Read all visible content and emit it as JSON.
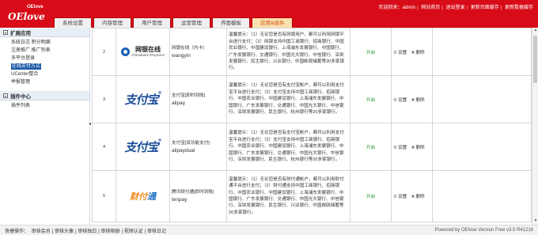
{
  "header": {
    "logo_small": "OElove",
    "logo_brand": "OElove",
    "toplinks": [
      "欢迎回来：admin",
      "网站首页",
      "退出登录",
      "更新页面缓存",
      "更新数据缓存"
    ],
    "tabs": [
      {
        "label": "系统设置",
        "active": false
      },
      {
        "label": "内容管理",
        "active": false
      },
      {
        "label": "用户管理",
        "active": false
      },
      {
        "label": "运营管理",
        "active": false
      },
      {
        "label": "界面模板",
        "active": false
      },
      {
        "label": "应用&插件",
        "active": true
      }
    ]
  },
  "sidebar": {
    "section1": "扩展应用",
    "items1": [
      "系统日志 积分明细",
      "注册推广 推广列表",
      "多平台登录",
      "在线支付方式",
      "UCenter整合",
      "举报管理"
    ],
    "active_item": "在线支付方式",
    "section2": "插件中心",
    "items2": [
      "插件列表"
    ]
  },
  "table": {
    "status_on": "开启",
    "op_set": "设置",
    "op_del": "删除",
    "rows": [
      {
        "idx": "2",
        "logo": "chinabank",
        "logo_text": "网银在线",
        "logo_sub": "Chinabank iPayment",
        "name": "网银在线（内卡）",
        "code": "wangyin",
        "desc": "温馨提示：（1）无论您是否有网银用户，都可以利用网银平台进行支付；（2）网银支持中国工商银行、招商银行、中国农业银行、中国建设银行、上海浦东发展银行、中国银行、广东发展银行、交通银行、中国光大银行、中信银行、深圳发展银行、民生银行、兴业银行、中国邮政储蓄等20多家银行。"
      },
      {
        "idx": "3",
        "logo": "alipay",
        "logo_text": "支付宝",
        "name": "支付宝[即时到账]",
        "code": "alipay",
        "desc": "温馨提示：（1）无论您是否有支付宝帐户，都可以利用支付宝平台进行支付；（2）支付宝支持中国工商银行、招商银行、中国农业银行、中国建设银行、上海浦东发展银行、中国银行、广东发展银行、交通银行、中国光大银行、中信银行、深圳发展银行、民生银行、杭州银行等20多家银行。"
      },
      {
        "idx": "4",
        "logo": "alipay",
        "logo_text": "支付宝",
        "name": "支付宝[双功能支付]",
        "code": "alipaydual",
        "desc": "温馨提示：（1）无论您是否有支付宝帐户，都可以利用支付宝平台进行支付；（2）支付宝支持中国工商银行、招商银行、中国农业银行、中国建设银行、上海浦东发展银行、中国银行、广东发展银行、交通银行、中国光大银行、中信银行、深圳发展银行、民生银行、杭州银行等20多家银行。"
      },
      {
        "idx": "5",
        "logo": "tenpay",
        "logo_text_a": "财付",
        "logo_text_b": "通",
        "name": "腾讯财付通[即时到账]",
        "code": "tenpay",
        "desc": "温馨提示：（1）无论您是否有财付通帐户，都可以利用财付通平台进行支付；（2）财付通支持中国工商银行、招商银行、中国农业银行、中国建设银行、上海浦东发展银行、中国银行、广东发展银行、交通银行、中国光大银行、中信银行、深圳发展银行、民生银行、兴业银行、中国邮政储蓄等20多家银行。"
      }
    ]
  },
  "footer": {
    "links": [
      "快捷操作：",
      "审核会员",
      "审核头像",
      "审核独白",
      "审核相册",
      "视频认证",
      "审核日记"
    ],
    "powered": "Powered by OElove Version Free v3.5 R41216"
  }
}
